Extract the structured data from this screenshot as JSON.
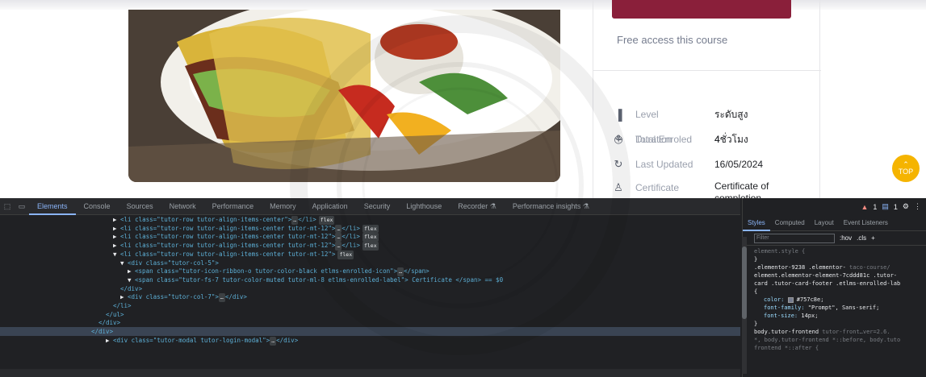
{
  "course_sidebar": {
    "free_access_text": "Free access this course",
    "meta": [
      {
        "icon": "level-icon",
        "label": "Level",
        "value": "ระดับสูง"
      },
      {
        "icon": "enrolled-icon",
        "label": "Total Enroled",
        "value": "4"
      },
      {
        "icon": "clock-icon",
        "label": "Duration",
        "value": "4ชั่วโมง"
      },
      {
        "icon": "refresh-icon",
        "label": "Last Updated",
        "value": "16/05/2024"
      },
      {
        "icon": "certificate-icon",
        "label": "Certificate",
        "value": "Certificate of completion"
      }
    ]
  },
  "top_button": {
    "arrow": "⌃",
    "label": "TOP"
  },
  "devtools": {
    "tabs": [
      "Elements",
      "Console",
      "Sources",
      "Network",
      "Performance",
      "Memory",
      "Application",
      "Security",
      "Lighthouse",
      "Recorder ⚗",
      "Performance insights ⚗"
    ],
    "status": {
      "errors": "1",
      "warnings": "1"
    },
    "dom_lines": [
      {
        "indent": 0,
        "text": "<li class=\"tutor-row tutor-align-items-center\">",
        "tail": "</li>",
        "badge": "flex"
      },
      {
        "indent": 0,
        "text": "<li class=\"tutor-row tutor-align-items-center tutor-mt-12\">",
        "tail": "</li>",
        "badge": "flex"
      },
      {
        "indent": 0,
        "text": "<li class=\"tutor-row tutor-align-items-center tutor-mt-12\">",
        "tail": "</li>",
        "badge": "flex"
      },
      {
        "indent": 0,
        "text": "<li class=\"tutor-row tutor-align-items-center tutor-mt-12\">",
        "tail": "</li>",
        "badge": "flex"
      },
      {
        "indent": 0,
        "text": "<li class=\"tutor-row tutor-align-items-center tutor-mt-12\">",
        "tail": "",
        "badge": "flex"
      },
      {
        "indent": 1,
        "text": "<div class=\"tutor-col-5\">",
        "tail": "",
        "badge": ""
      },
      {
        "indent": 2,
        "text": "<span class=\"tutor-icon-ribbon-o tutor-color-black etlms-enrolled-icon\">",
        "tail": "</span>",
        "badge": ""
      },
      {
        "indent": 2,
        "text": "<span class=\"tutor-fs-7 tutor-color-muted tutor-ml-8 etlms-enrolled-label\"> Certificate </span> == $0",
        "tail": "",
        "badge": ""
      },
      {
        "indent": 1,
        "text": "</div>",
        "tail": "",
        "badge": ""
      },
      {
        "indent": 1,
        "text": "<div class=\"tutor-col-7\">",
        "tail": "</div>",
        "badge": ""
      },
      {
        "indent": 0,
        "text": "</li>",
        "tail": "",
        "badge": ""
      },
      {
        "indent": -1,
        "text": "</ul>",
        "tail": "",
        "badge": ""
      },
      {
        "indent": -2,
        "text": "</div>",
        "tail": "",
        "badge": ""
      },
      {
        "indent": -3,
        "text": "</div>",
        "tail": "",
        "badge": ""
      },
      {
        "indent": -1,
        "text": "<div class=\"tutor-modal tutor-login-modal\">",
        "tail": "</div>",
        "badge": ""
      }
    ],
    "styles_tabs": [
      "Styles",
      "Computed",
      "Layout",
      "Event Listeners"
    ],
    "filter_placeholder": "Filter",
    "filter_options": [
      ":hov",
      ".cls",
      "+"
    ],
    "rules": {
      "element_style": "element.style {",
      "close": "}",
      "selector": ".elementor-9238 .elementor-",
      "selector2": "element.elementor-element-7cddd81c .tutor-",
      "selector3": "card .tutor-card-footer .etlms-enrolled-lab",
      "source": "taco-course/",
      "open": "{",
      "props": [
        {
          "name": "color:",
          "value": "#757c8e;",
          "swatch": "#757c8e"
        },
        {
          "name": "font-family:",
          "value": "\"Prompt\", Sans-serif;"
        },
        {
          "name": "font-size:",
          "value": "14px;"
        }
      ],
      "next_selector": "body.tutor-frontend",
      "next_source": "tutor-front…ver=2.6.",
      "next_sub": "*, body.tutor-frontend *::before, body.tuto",
      "next_sub2": "frontend *::after {"
    }
  },
  "colors": {
    "accent": "#8a1f3a",
    "top_button": "#f5b400",
    "devtools_bg": "#202124",
    "link": "#8ab4f8"
  }
}
